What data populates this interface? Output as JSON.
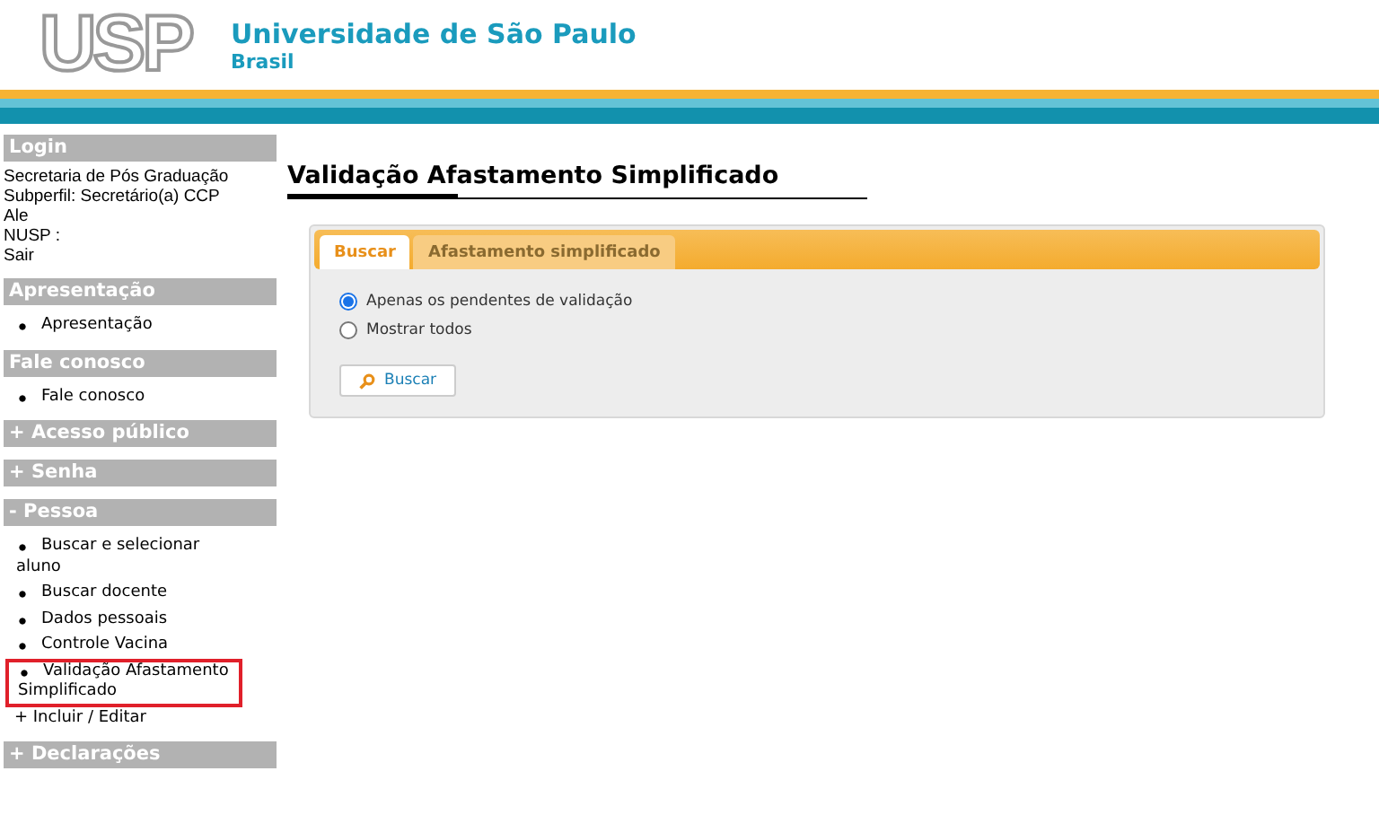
{
  "header": {
    "logo": "USP",
    "title": "Universidade de São Paulo",
    "subtitle": "Brasil"
  },
  "sidebar": [
    {
      "kind": "info",
      "heading": "Login",
      "lines": [
        "Secretaria de Pós Graduação",
        "Subperfil: Secretário(a) CCP",
        "Ale",
        "NUSP :",
        "Sair"
      ]
    },
    {
      "kind": "list",
      "heading": "Apresentação",
      "items": [
        {
          "kind": "bullet",
          "label": "Apresentação",
          "highlighted": false
        }
      ]
    },
    {
      "kind": "list",
      "heading": "Fale conosco",
      "items": [
        {
          "kind": "bullet",
          "label": "Fale conosco",
          "highlighted": false
        }
      ]
    },
    {
      "kind": "list",
      "heading": "+ Acesso público"
    },
    {
      "kind": "list",
      "heading": "+ Senha"
    },
    {
      "kind": "list",
      "heading": "- Pessoa",
      "items": [
        {
          "kind": "bullet",
          "label": "Buscar e selecionar aluno",
          "highlighted": false
        },
        {
          "kind": "bullet",
          "label": "Buscar docente",
          "highlighted": false
        },
        {
          "kind": "bullet",
          "label": "Dados pessoais",
          "highlighted": false
        },
        {
          "kind": "bullet",
          "label": "Controle Vacina",
          "highlighted": false
        },
        {
          "kind": "bullet",
          "label": "Validação Afastamento Simplificado",
          "highlighted": true
        },
        {
          "kind": "plain",
          "label": "+ Incluir / Editar",
          "highlighted": false
        }
      ]
    },
    {
      "kind": "list",
      "heading": "+ Declarações"
    }
  ],
  "page_title": "Validação Afastamento Simplificado",
  "tabs": [
    {
      "label": "Buscar",
      "selected": true
    },
    {
      "label": "Afastamento simplificado",
      "selected": false
    }
  ],
  "options": [
    {
      "label": "Apenas os pendentes de validação",
      "selected": true
    },
    {
      "label": "Mostrar todos",
      "selected": false
    }
  ],
  "search_button": "Buscar"
}
